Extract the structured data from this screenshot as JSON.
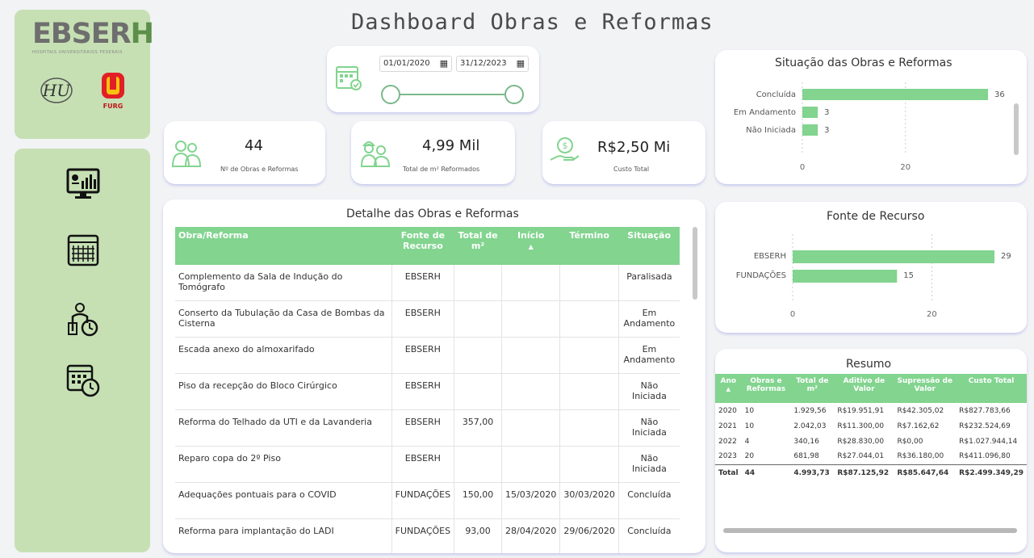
{
  "header": {
    "title": "Dashboard Obras e Reformas"
  },
  "logos": {
    "brand": "EBSERH",
    "brand_sub": "HOSPITAIS UNIVERSITÁRIOS FEDERAIS",
    "hu": "HU",
    "furg": "FURG"
  },
  "nav": [
    "monitor-chart-icon",
    "calendar-grid-icon",
    "person-clock-icon",
    "calendar-clock-icon"
  ],
  "date_filter": {
    "start": "01/01/2020",
    "end": "31/12/2023"
  },
  "kpis": [
    {
      "value": "44",
      "label": "Nº de Obras e Reformas"
    },
    {
      "value": "4,99 Mil",
      "label": "Total de m² Reformados"
    },
    {
      "value": "R$2,50 Mi",
      "label": "Custo Total"
    }
  ],
  "detail": {
    "title": "Detalhe das Obras e Reformas",
    "columns": [
      "Obra/Reforma",
      "Fonte de Recurso",
      "Total de m²",
      "Início",
      "Término",
      "Situação"
    ],
    "rows": [
      [
        "Complemento da Sala de Indução do Tomógrafo",
        "EBSERH",
        "",
        "",
        "",
        "Paralisada"
      ],
      [
        "Conserto da Tubulação da Casa de Bombas da Cisterna",
        "EBSERH",
        "",
        "",
        "",
        "Em Andamento"
      ],
      [
        "Escada anexo do almoxarifado",
        "EBSERH",
        "",
        "",
        "",
        "Em Andamento"
      ],
      [
        "Piso da recepção do Bloco Cirúrgico",
        "EBSERH",
        "",
        "",
        "",
        "Não Iniciada"
      ],
      [
        "Reforma do Telhado da UTI e da Lavanderia",
        "EBSERH",
        "357,00",
        "",
        "",
        "Não Iniciada"
      ],
      [
        "Reparo copa do 2º Piso",
        "EBSERH",
        "",
        "",
        "",
        "Não Iniciada"
      ],
      [
        "Adequações pontuais para o COVID",
        "FUNDAÇÕES",
        "150,00",
        "15/03/2020",
        "30/03/2020",
        "Concluída"
      ],
      [
        "Reforma para implantação do LADI",
        "FUNDAÇÕES",
        "93,00",
        "28/04/2020",
        "29/06/2020",
        "Concluída"
      ]
    ]
  },
  "situacao": {
    "title": "Situação das Obras e Reformas",
    "ticks": [
      "0",
      "20"
    ]
  },
  "fonte": {
    "title": "Fonte de Recurso",
    "ticks": [
      "0",
      "20"
    ]
  },
  "resumo": {
    "title": "Resumo",
    "columns": [
      "Ano",
      "Obras e Reformas",
      "Total de m²",
      "Aditivo de Valor",
      "Supressão de Valor",
      "Custo Total"
    ],
    "rows": [
      [
        "2020",
        "10",
        "1.929,56",
        "R$19.951,91",
        "R$42.305,02",
        "R$827.783,66"
      ],
      [
        "2021",
        "10",
        "2.042,03",
        "R$11.300,00",
        "R$7.162,62",
        "R$232.524,69"
      ],
      [
        "2022",
        "4",
        "340,16",
        "R$28.830,00",
        "R$0,00",
        "R$1.027.944,14"
      ],
      [
        "2023",
        "20",
        "681,98",
        "R$27.044,01",
        "R$36.180,00",
        "R$411.096,80"
      ]
    ],
    "total": [
      "Total",
      "44",
      "4.993,73",
      "R$87.125,92",
      "R$85.647,64",
      "R$2.499.349,29"
    ]
  },
  "chart_data": [
    {
      "type": "bar",
      "orientation": "horizontal",
      "title": "Situação das Obras e Reformas",
      "categories": [
        "Concluída",
        "Em Andamento",
        "Não Iniciada"
      ],
      "values": [
        36,
        3,
        3
      ],
      "xlim": [
        0,
        36
      ]
    },
    {
      "type": "bar",
      "orientation": "horizontal",
      "title": "Fonte de Recurso",
      "categories": [
        "EBSERH",
        "FUNDAÇÕES"
      ],
      "values": [
        29,
        15
      ],
      "xlim": [
        0,
        29
      ]
    }
  ],
  "colors": {
    "accent": "#82d48f",
    "sidebar": "#c6e0b4",
    "card_shadow": "#7882dc"
  }
}
